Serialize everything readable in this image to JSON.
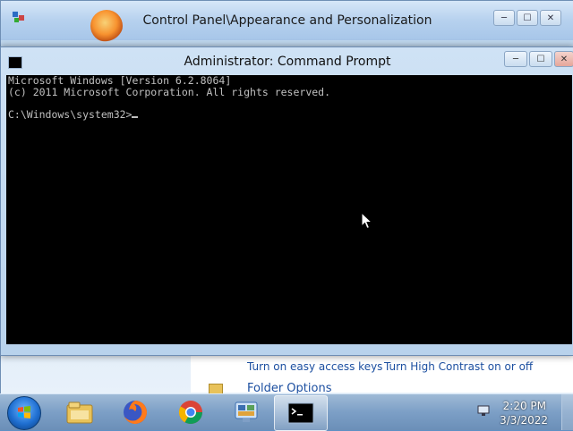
{
  "bg_window": {
    "title": "Control Panel\\Appearance and Personalization",
    "buttons": {
      "minimize": "─",
      "maximize": "☐",
      "close": "✕"
    },
    "links": {
      "easy_access": "Turn on easy access keys",
      "high_contrast": "Turn High Contrast on or off",
      "folder_options": "Folder Options"
    }
  },
  "cmd_window": {
    "title": "Administrator: Command Prompt",
    "buttons": {
      "minimize": "─",
      "maximize": "☐",
      "close": "✕"
    },
    "lines": [
      "Microsoft Windows [Version 6.2.8064]",
      "(c) 2011 Microsoft Corporation. All rights reserved.",
      "",
      "C:\\Windows\\system32>"
    ]
  },
  "taskbar": {
    "apps": [
      {
        "name": "file-explorer-icon"
      },
      {
        "name": "firefox-icon"
      },
      {
        "name": "chrome-icon"
      },
      {
        "name": "control-panel-icon"
      },
      {
        "name": "command-prompt-icon"
      }
    ],
    "clock": {
      "time": "2:20 PM",
      "date": "3/3/2022"
    }
  },
  "colors": {
    "console_bg": "#000000",
    "console_text": "#c0c0c0",
    "link": "#1c4fa0"
  }
}
